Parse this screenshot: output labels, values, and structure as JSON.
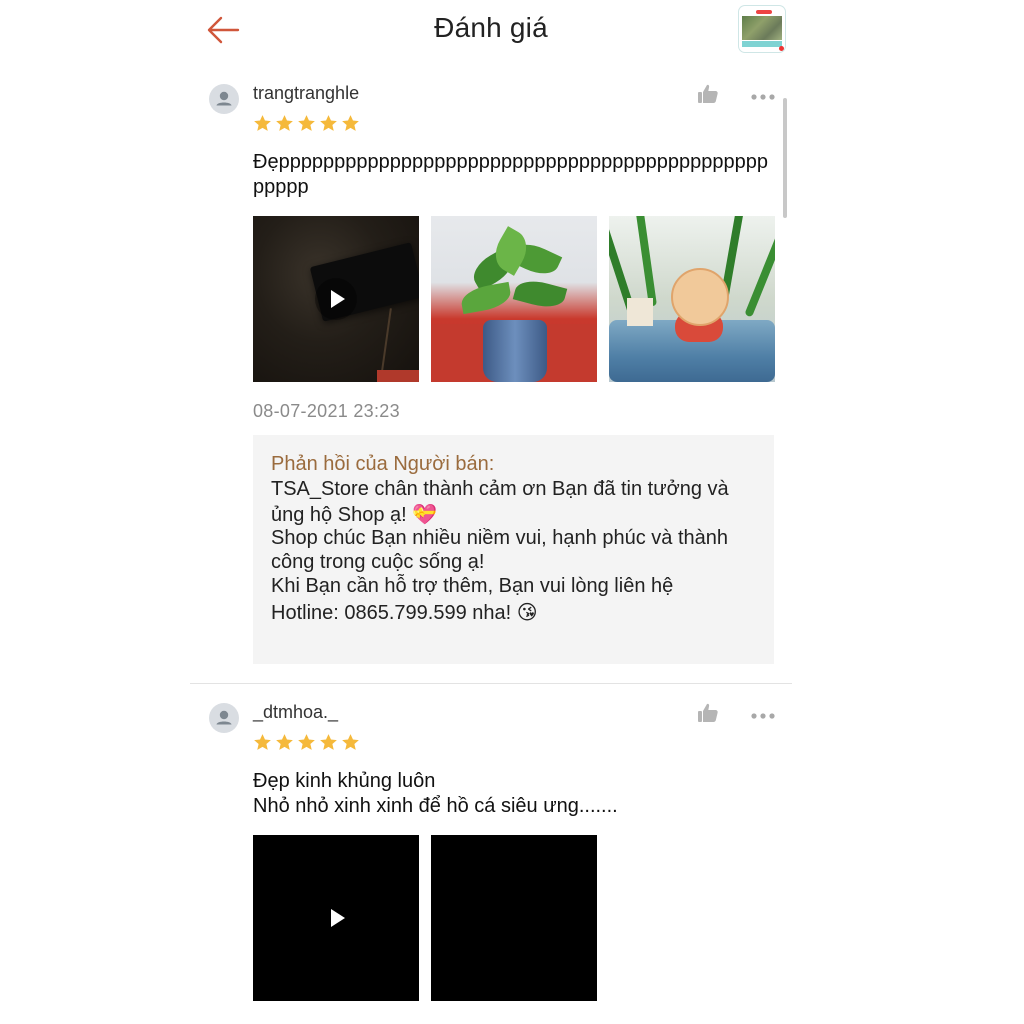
{
  "header": {
    "title": "Đánh giá",
    "back_icon": "arrow-left-icon",
    "accent_color": "#d0563a"
  },
  "reviews": [
    {
      "username": "trangtranghle",
      "rating": 5,
      "text": "Đẹppppppppppppppppppppppppppppppppppppppppppppppppp",
      "media": [
        {
          "kind": "video",
          "icon": "play-icon"
        },
        {
          "kind": "image"
        },
        {
          "kind": "image"
        }
      ],
      "timestamp": "08-07-2021 23:23",
      "seller_reply": {
        "label": "Phản hồi của Người bán:",
        "lines": [
          "TSA_Store chân thành cảm ơn Bạn đã tin tưởng và",
          "ủng hộ Shop ạ! 💝",
          "Shop chúc Bạn nhiều niềm vui, hạnh phúc và thành",
          "công trong cuộc sống ạ!",
          "Khi Bạn cần hỗ trợ thêm, Bạn vui lòng liên hệ",
          "Hotline: 0865.799.599 nha! 😘"
        ]
      }
    },
    {
      "username": "_dtmhoa._",
      "rating": 5,
      "text_lines": [
        "Đẹp kinh khủng luôn",
        "Nhỏ nhỏ xinh xinh để hồ cá siêu ưng......."
      ],
      "media": [
        {
          "kind": "video",
          "icon": "play-icon"
        },
        {
          "kind": "image"
        }
      ]
    }
  ],
  "colors": {
    "star": "#f5b93b",
    "seller_label": "#9a6b3d",
    "timestamp": "#8a8a8a"
  }
}
